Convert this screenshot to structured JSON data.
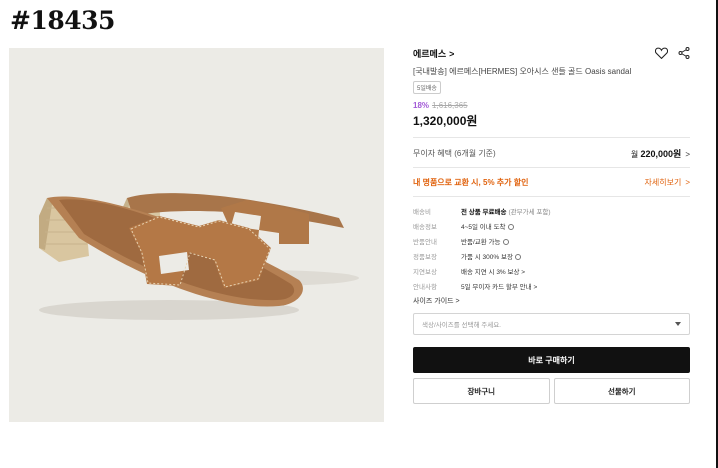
{
  "listing_id": "#18435",
  "product": {
    "brand": "에르메스",
    "brand_chevron": ">",
    "title": "[국내발송] 에르메스[HERMES] 오아시스 샌들 골드 Oasis sandal",
    "delivery_tag": "5일배송",
    "discount": "18%",
    "original_price": "1,616,365",
    "price": "1,320,000원",
    "image_alt": "Hermes Oasis sandal in gold leather"
  },
  "icons": {
    "wishlist": "heart-icon",
    "share": "share-icon"
  },
  "installment": {
    "label": "무이자 혜택",
    "sub": "(6개월 기준)",
    "prefix": "월",
    "amount": "220,000원",
    "arrow": ">"
  },
  "trade_in": {
    "label": "내 명품으로 교환 시, 5% 추가 할인",
    "link": "자세히보기",
    "arrow": ">"
  },
  "info_rows": [
    {
      "label": "배송비",
      "value": "전 상품 무료배송",
      "sub": "(관부가세 포함)"
    },
    {
      "label": "배송정보",
      "value": "4~5일 이내 도착"
    },
    {
      "label": "반품안내",
      "value": "반품/교환 가능"
    },
    {
      "label": "정품보장",
      "value": "가품 시 300% 보장"
    },
    {
      "label": "지연보상",
      "value": "배송 지연 시 3% 보상",
      "suffix": ">"
    },
    {
      "label": "안내사항",
      "value": "5일 무이자 카드 할부 안내",
      "suffix": ">"
    }
  ],
  "size_guide": "사이즈 가이드 >",
  "select": {
    "placeholder": "색상/사이즈를 선택해 주세요."
  },
  "buttons": {
    "buy_now": "바로 구매하기",
    "cart": "장바구니",
    "gift": "선물하기"
  },
  "colors": {
    "accent_discount": "#a25ad6",
    "accent_trade": "#e0620d",
    "buy_button_bg": "#111111"
  }
}
